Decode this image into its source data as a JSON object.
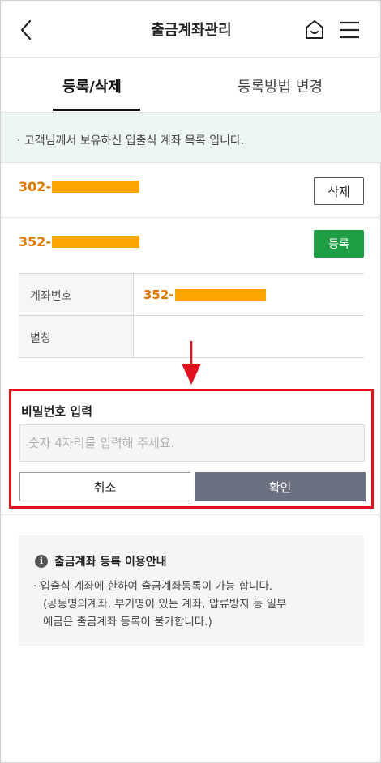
{
  "header": {
    "title": "출금계좌관리",
    "back_icon": "chevron-left-icon",
    "home_icon": "home-icon",
    "menu_icon": "hamburger-menu-icon"
  },
  "tabs": [
    {
      "label": "등록/삭제",
      "active": true
    },
    {
      "label": "등록방법 변경",
      "active": false
    }
  ],
  "notice": {
    "text": "· 고객님께서 보유하신 입출식 계좌 목록 입니다."
  },
  "accounts": [
    {
      "prefix": "302-",
      "action_label": "삭제"
    },
    {
      "prefix": "352-",
      "action_label": "등록"
    }
  ],
  "detail": {
    "account_label": "계좌번호",
    "account_prefix": "352-",
    "nickname_label": "별칭",
    "nickname_value": ""
  },
  "password": {
    "label": "비밀번호 입력",
    "placeholder": "숫자 4자리를 입력해 주세요.",
    "cancel_label": "취소",
    "confirm_label": "확인"
  },
  "guide": {
    "title": "출금계좌 등록 이용안내",
    "lines": [
      "· 입출식 계좌에 한하여 출금계좌등록이 가능 합니다.",
      "(공동명의계좌, 부기명이 있는 계좌, 압류방지 등 일부",
      "예금은 출금계좌 등록이 불가합니다.)"
    ]
  },
  "colors": {
    "accent_orange": "#e07800",
    "mask_orange": "#ffa500",
    "register_green": "#1f9e45",
    "highlight_red": "#e0101c",
    "confirm_gray": "#6b7180"
  }
}
